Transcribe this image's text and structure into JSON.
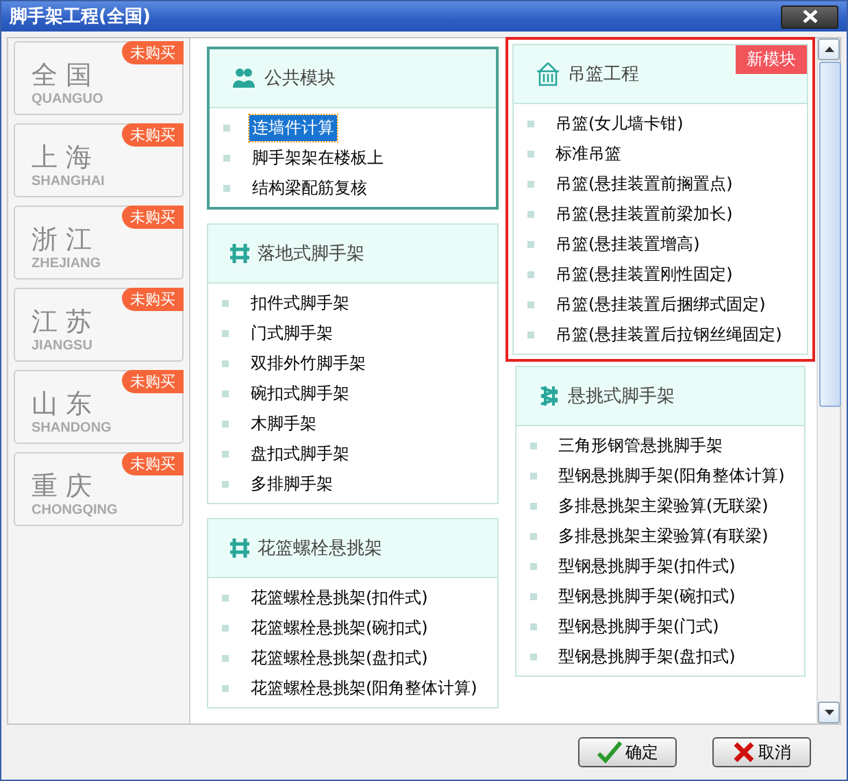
{
  "window": {
    "title": "脚手架工程(全国)"
  },
  "regions": [
    {
      "name": "全国",
      "pinyin": "QUANGUO",
      "badge": "未购买"
    },
    {
      "name": "上海",
      "pinyin": "SHANGHAI",
      "badge": "未购买"
    },
    {
      "name": "浙江",
      "pinyin": "ZHEJIANG",
      "badge": "未购买"
    },
    {
      "name": "江苏",
      "pinyin": "JIANGSU",
      "badge": "未购买"
    },
    {
      "name": "山东",
      "pinyin": "SHANDONG",
      "badge": "未购买"
    },
    {
      "name": "重庆",
      "pinyin": "CHONGQING",
      "badge": "未购买"
    }
  ],
  "columns": [
    {
      "cards": [
        {
          "kind": "public",
          "title": "公共模块",
          "selected": true,
          "highlighted": false,
          "items": [
            {
              "label": "连墙件计算",
              "selected": true
            },
            {
              "label": "脚手架架在楼板上",
              "selected": false
            },
            {
              "label": "结构梁配筋复核",
              "selected": false
            }
          ]
        },
        {
          "kind": "frame",
          "title": "落地式脚手架",
          "selected": false,
          "highlighted": false,
          "items": [
            {
              "label": "扣件式脚手架",
              "selected": false
            },
            {
              "label": "门式脚手架",
              "selected": false
            },
            {
              "label": "双排外竹脚手架",
              "selected": false
            },
            {
              "label": "碗扣式脚手架",
              "selected": false
            },
            {
              "label": "木脚手架",
              "selected": false
            },
            {
              "label": "盘扣式脚手架",
              "selected": false
            },
            {
              "label": "多排脚手架",
              "selected": false
            }
          ]
        },
        {
          "kind": "frame",
          "title": "花篮螺栓悬挑架",
          "selected": false,
          "highlighted": false,
          "items": [
            {
              "label": "花篮螺栓悬挑架(扣件式)",
              "selected": false
            },
            {
              "label": "花篮螺栓悬挑架(碗扣式)",
              "selected": false
            },
            {
              "label": "花篮螺栓悬挑架(盘扣式)",
              "selected": false
            },
            {
              "label": "花篮螺栓悬挑架(阳角整体计算)",
              "selected": false
            }
          ]
        }
      ]
    },
    {
      "cards": [
        {
          "kind": "basket",
          "title": "吊篮工程",
          "badge": "新模块",
          "selected": false,
          "highlighted": true,
          "items": [
            {
              "label": "吊篮(女儿墙卡钳)",
              "selected": false
            },
            {
              "label": "标准吊篮",
              "selected": false
            },
            {
              "label": "吊篮(悬挂装置前搁置点)",
              "selected": false
            },
            {
              "label": "吊篮(悬挂装置前梁加长)",
              "selected": false
            },
            {
              "label": "吊篮(悬挂装置增高)",
              "selected": false
            },
            {
              "label": "吊篮(悬挂装置刚性固定)",
              "selected": false
            },
            {
              "label": "吊篮(悬挂装置后捆绑式固定)",
              "selected": false
            },
            {
              "label": "吊篮(悬挂装置后拉钢丝绳固定)",
              "selected": false
            }
          ]
        },
        {
          "kind": "cantilever",
          "title": "悬挑式脚手架",
          "selected": false,
          "highlighted": false,
          "items": [
            {
              "label": "三角形钢管悬挑脚手架",
              "selected": false
            },
            {
              "label": "型钢悬挑脚手架(阳角整体计算)",
              "selected": false
            },
            {
              "label": "多排悬挑架主梁验算(无联梁)",
              "selected": false
            },
            {
              "label": "多排悬挑架主梁验算(有联梁)",
              "selected": false
            },
            {
              "label": "型钢悬挑脚手架(扣件式)",
              "selected": false
            },
            {
              "label": "型钢悬挑脚手架(碗扣式)",
              "selected": false
            },
            {
              "label": "型钢悬挑脚手架(门式)",
              "selected": false
            },
            {
              "label": "型钢悬挑脚手架(盘扣式)",
              "selected": false
            }
          ]
        }
      ]
    }
  ],
  "buttons": [
    {
      "kind": "ok",
      "label": "确定"
    },
    {
      "kind": "cancel",
      "label": "取消"
    }
  ]
}
